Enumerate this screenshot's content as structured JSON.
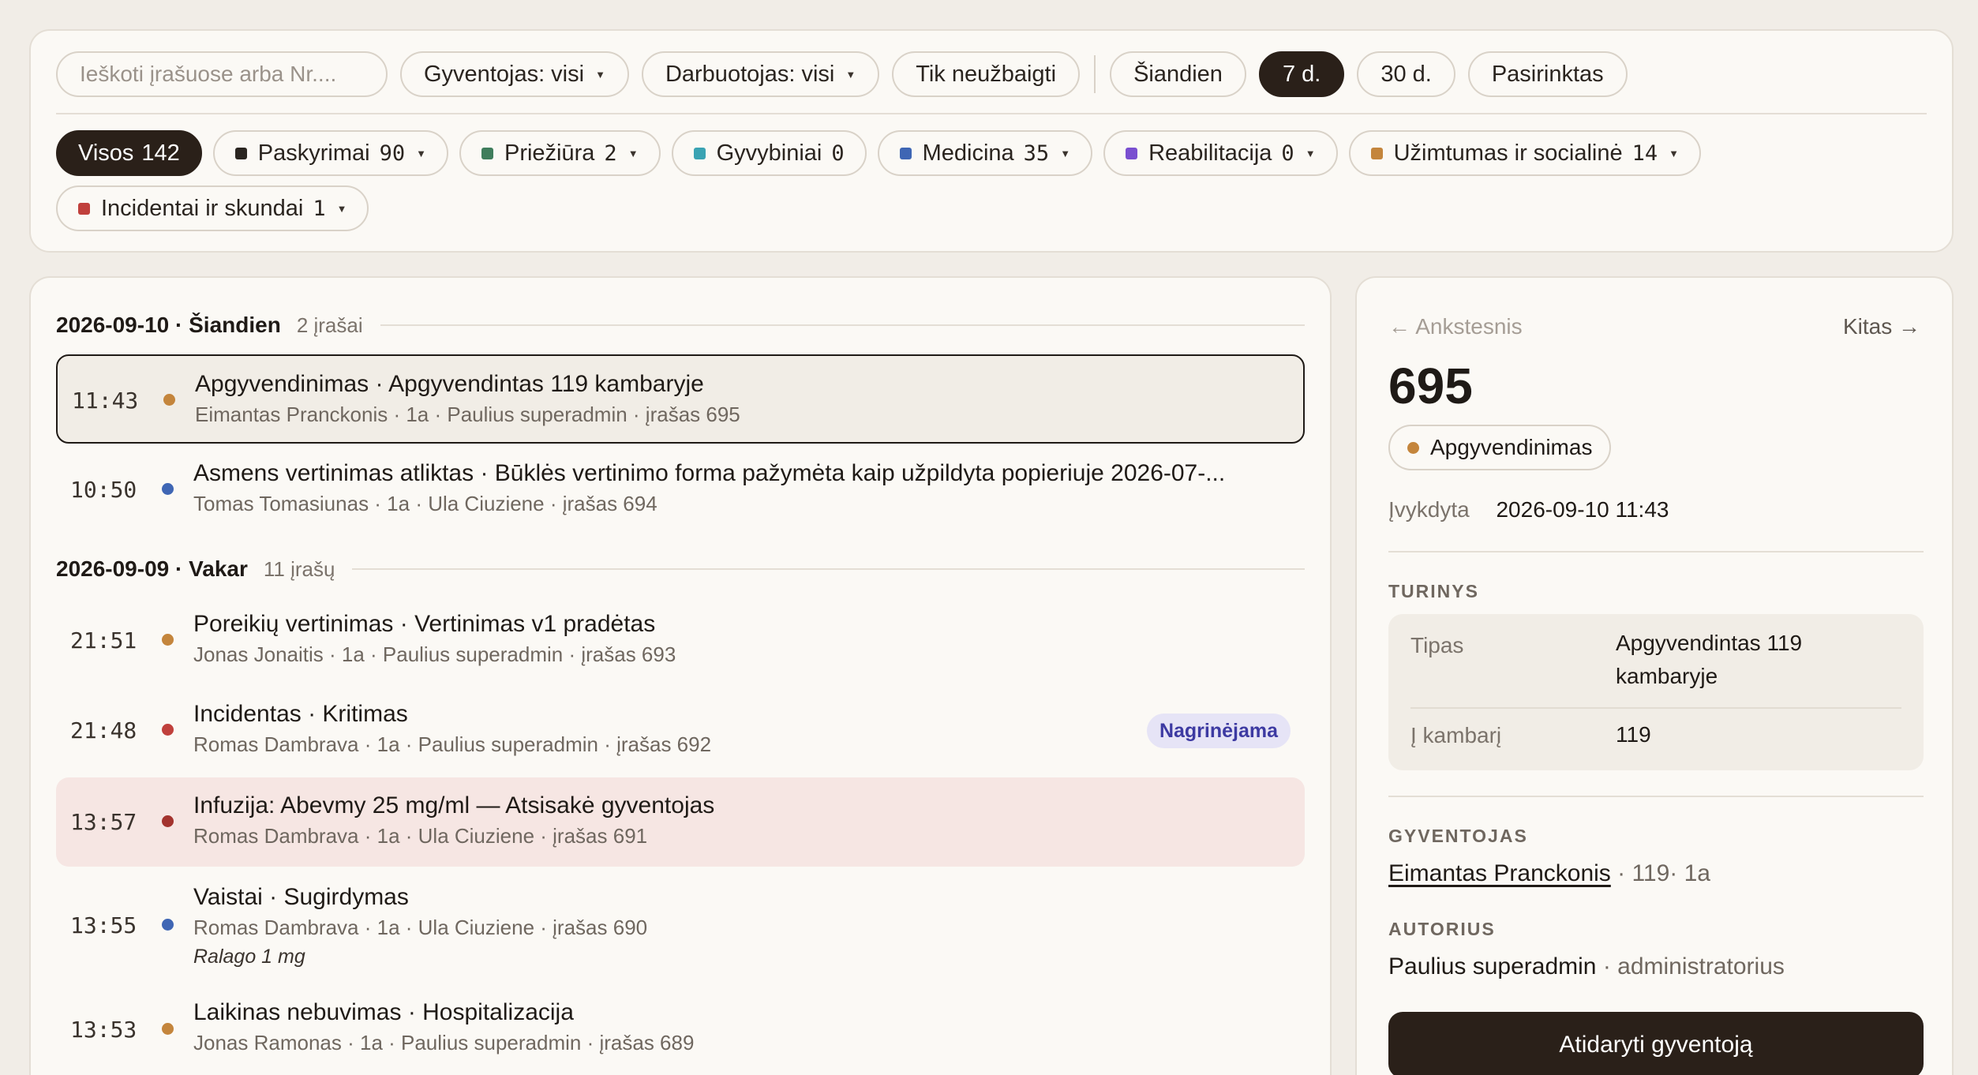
{
  "filters": {
    "search_placeholder": "Ieškoti įrašuose arba Nr....",
    "resident": "Gyventojas: visi",
    "employee": "Darbuotojas: visi",
    "incomplete": "Tik neužbaigti",
    "periods": [
      "Šiandien",
      "7 d.",
      "30 d.",
      "Pasirinktas"
    ],
    "active_period": "7 d."
  },
  "categories": [
    {
      "label": "Visos",
      "count": "142",
      "active": true
    },
    {
      "label": "Paskyrimai",
      "count": "90",
      "color": "#2a2520"
    },
    {
      "label": "Priežiūra",
      "count": "2",
      "color": "#3f7d5c"
    },
    {
      "label": "Gyvybiniai",
      "count": "0",
      "color": "#3aa3b3"
    },
    {
      "label": "Medicina",
      "count": "35",
      "color": "#3f66b4"
    },
    {
      "label": "Reabilitacija",
      "count": "0",
      "color": "#7a4fd0"
    },
    {
      "label": "Užimtumas ir socialinė",
      "count": "14",
      "color": "#c4853c"
    },
    {
      "label": "Incidentai ir skundai",
      "count": "1",
      "color": "#c0403c"
    }
  ],
  "days": [
    {
      "date": "2026-09-10 · Šiandien",
      "count": "2 įrašai",
      "entries": [
        {
          "time": "11:43",
          "dot": "#c4853c",
          "title": "Apgyvendinimas · Apgyvendintas 119 kambaryje",
          "meta": "Eimantas Pranckonis · 1a · Paulius superadmin · įrašas 695"
        },
        {
          "time": "10:50",
          "dot": "#3f66b4",
          "title": "Asmens vertinimas atliktas · Būklės vertinimo forma pažymėta kaip užpildyta popieriuje 2026-07-...",
          "meta": "Tomas Tomasiunas · 1a · Ula Ciuziene · įrašas 694"
        }
      ]
    },
    {
      "date": "2026-09-09 · Vakar",
      "count": "11 įrašų",
      "entries": [
        {
          "time": "21:51",
          "dot": "#c4853c",
          "title": "Poreikių vertinimas · Vertinimas v1 pradėtas",
          "meta": "Jonas Jonaitis · 1a · Paulius superadmin · įrašas 693"
        },
        {
          "time": "21:48",
          "dot": "#c0403c",
          "title": "Incidentas · Kritimas",
          "meta": "Romas Dambrava · 1a · Paulius superadmin · įrašas 692",
          "badge": "Nagrinėjama"
        },
        {
          "time": "13:57",
          "dot": "#a3332e",
          "title": "Infuzija: Abevmy 25 mg/ml — Atsisakė gyventojas",
          "meta": "Romas Dambrava · 1a · Ula Ciuziene · įrašas 691"
        },
        {
          "time": "13:55",
          "dot": "#3f66b4",
          "title": "Vaistai · Sugirdymas",
          "meta": "Romas Dambrava · 1a · Ula Ciuziene · įrašas 690",
          "note": "Ralago 1 mg"
        },
        {
          "time": "13:53",
          "dot": "#c4853c",
          "title": "Laikinas nebuvimas · Hospitalizacija",
          "meta": "Jonas Ramonas · 1a · Paulius superadmin · įrašas 689"
        }
      ]
    }
  ],
  "detail": {
    "prev": "← Ankstesnis",
    "next": "Kitas →",
    "id": "695",
    "type": "Apgyvendinimas",
    "type_color": "#c4853c",
    "executed_label": "Įvykdyta",
    "executed_value": "2026-09-10 11:43",
    "content_label": "TURINYS",
    "fields": [
      {
        "key": "Tipas",
        "value": "Apgyvendintas 119 kambaryje"
      },
      {
        "key": "Į kambarį",
        "value": "119"
      }
    ],
    "resident_label": "GYVENTOJAS",
    "resident_name": "Eimantas Pranckonis",
    "resident_extra": " · 119· 1a",
    "author_label": "AUTORIUS",
    "author_name": "Paulius superadmin",
    "author_role": " · administratorius",
    "open_button": "Atidaryti gyventoją"
  }
}
